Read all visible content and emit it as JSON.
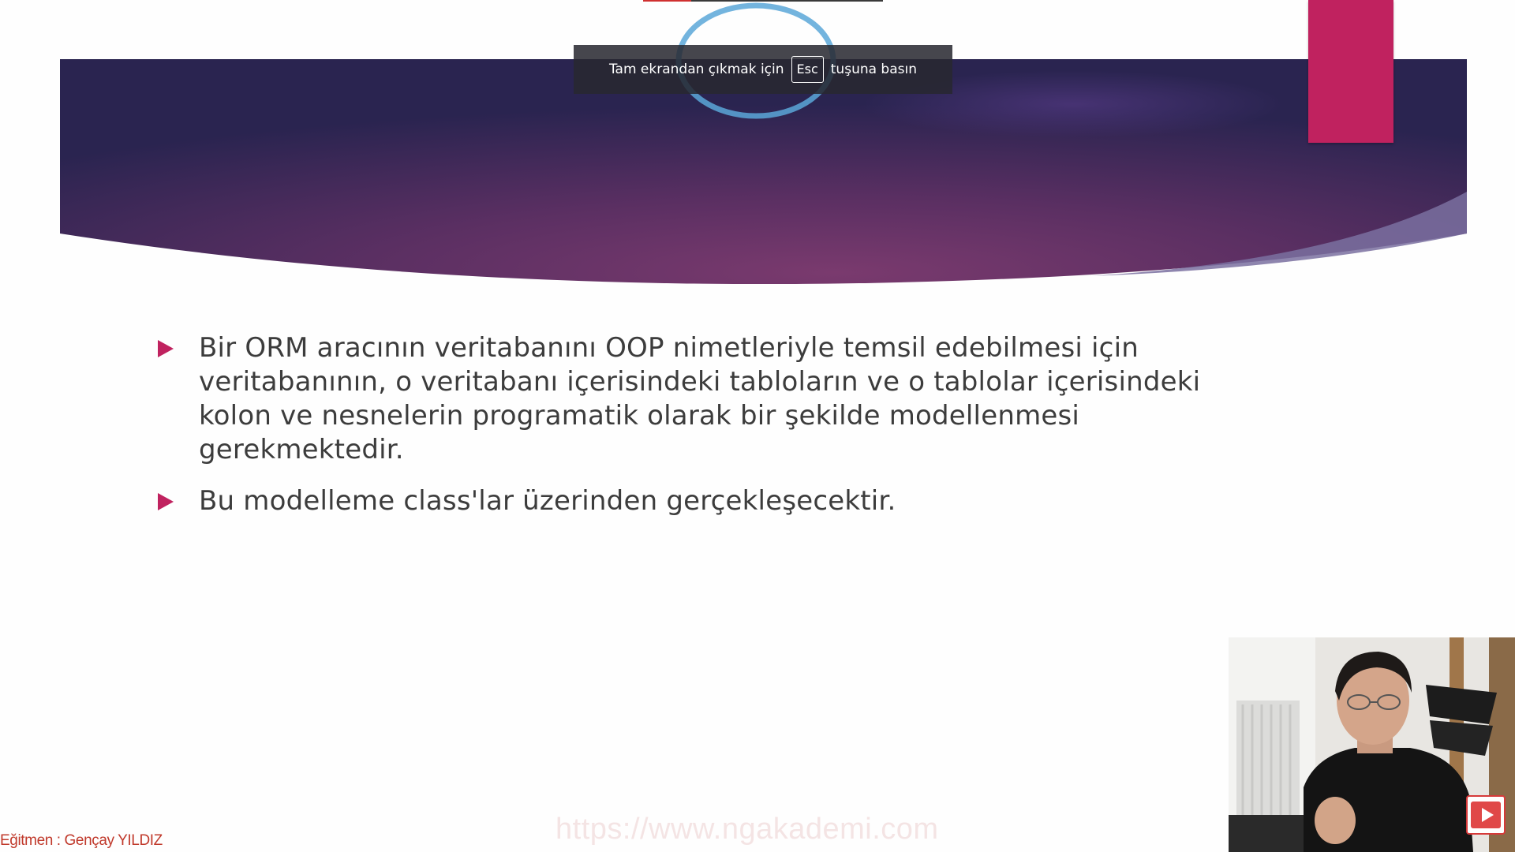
{
  "notification": {
    "prefix": "Tam ekrandan çıkmak için",
    "key": "Esc",
    "suffix": "tuşuna basın"
  },
  "slide": {
    "bullets": [
      {
        "text": "Bir ORM aracının veritabanını OOP nimetleriyle temsil edebilmesi için veritabanının, o veritabanı içerisindeki tabloların ve o tablolar içerisindeki kolon ve nesnelerin programatik olarak bir şekilde modellenmesi gerekmektedir."
      },
      {
        "text": "Bu modelleme class'lar üzerinden gerçekleşecektir."
      }
    ]
  },
  "watermark": {
    "instructor": "Eğitmen : Gençay YILDIZ",
    "url": "https://www.ngakademi.com"
  },
  "player": {
    "progress_fraction": 0.2
  },
  "colors": {
    "accent": "#c0225f",
    "banner_dark": "#2c2450",
    "banner_mid": "#6a3466"
  },
  "icons": {
    "bullet": "triangle-right-icon",
    "badge": "play-icon"
  }
}
